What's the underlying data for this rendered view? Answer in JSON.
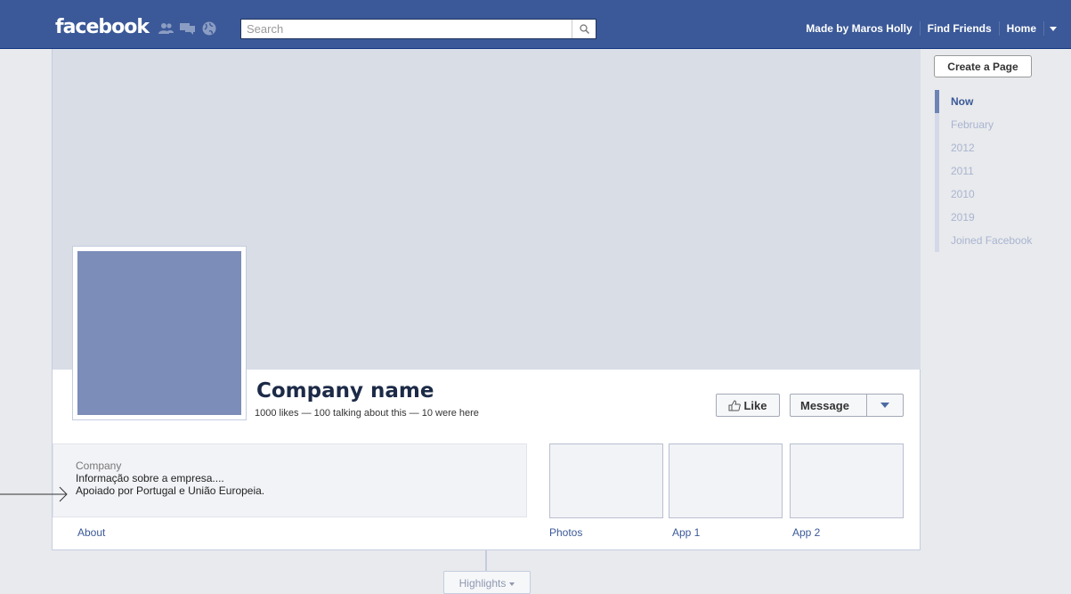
{
  "colors": {
    "topbar": "#3b5998",
    "cover": "#d9dde6",
    "profile_picture": "#7b8db8",
    "link": "#3b5998",
    "background": "#e9eaed"
  },
  "header": {
    "logo": "facebook",
    "jewels": [
      "friend-requests-icon",
      "messages-icon",
      "notifications-globe-icon"
    ],
    "search": {
      "placeholder": "Search",
      "value": "",
      "button_icon": "magnifier-icon"
    },
    "links": [
      "Made by Maros Holly",
      "Find Friends",
      "Home"
    ],
    "menu_icon": "caret-down-icon"
  },
  "page": {
    "name": "Company name",
    "stats": "1000 likes — 100 talking about this — 10 were here",
    "like_label": "Like",
    "message_label": "Message"
  },
  "about": {
    "category": "Company",
    "lines": [
      "Informação sobre a empresa....",
      "Apoiado por Portugal e União Europeia."
    ]
  },
  "tabs": [
    "About",
    "Photos",
    "App 1",
    "App 2"
  ],
  "sidebar": {
    "create_page_label": "Create a Page",
    "scrubber": [
      "Now",
      "February",
      "2012",
      "2011",
      "2010",
      "2019",
      "Joined Facebook"
    ]
  },
  "highlights_label": "Highlights"
}
